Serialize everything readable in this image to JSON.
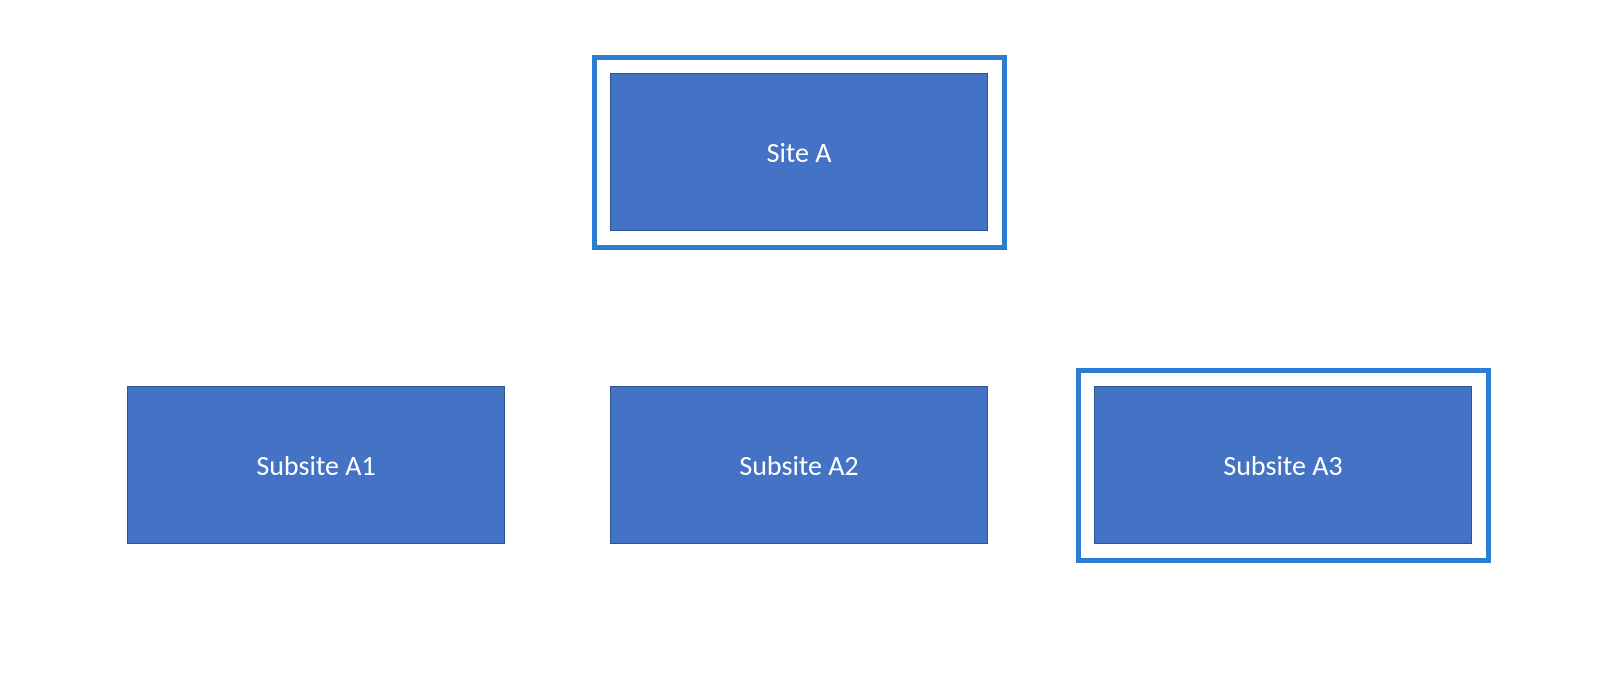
{
  "diagram": {
    "parent": {
      "label": "Site A",
      "highlighted": true
    },
    "children": [
      {
        "label": "Subsite A1",
        "highlighted": false
      },
      {
        "label": "Subsite A2",
        "highlighted": false
      },
      {
        "label": "Subsite A3",
        "highlighted": true
      }
    ],
    "colors": {
      "box_fill": "#4472c4",
      "box_border": "#2f528f",
      "highlight_border": "#2b7cd3",
      "text": "#ffffff"
    }
  }
}
